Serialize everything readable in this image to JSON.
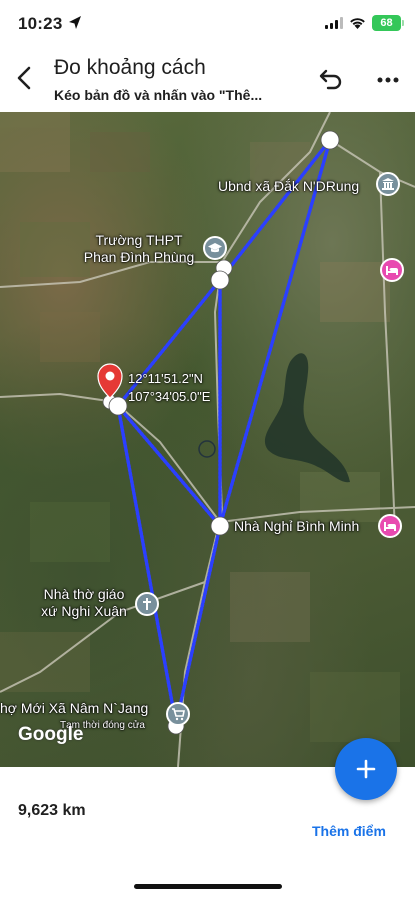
{
  "status_bar": {
    "time": "10:23",
    "battery": "68",
    "icons": [
      "location-arrow-icon",
      "signal-icon",
      "wifi-icon",
      "battery-icon"
    ]
  },
  "header": {
    "title": "Đo khoảng cách",
    "subtitle": "Kéo bản đồ và nhấn vào \"Thê...",
    "icons": [
      "back-arrow-icon",
      "undo-icon",
      "more-vert-icon"
    ]
  },
  "map": {
    "labels": {
      "ubnd": "Ubnd xã Đắk N'DRung",
      "truong_line1": "Trường THPT",
      "truong_line2": "Phan Đình Phùng",
      "nha_nghi": "Nhà Nghỉ Bình Minh",
      "nha_tho_line1": "Nhà thờ giáo",
      "nha_tho_line2": "xứ Nghi Xuân",
      "cho_moi": "hợ Mới Xã Nâm N`Jang",
      "tam_thoi": "Tạm thời đóng cửa"
    },
    "coordinates": {
      "lat": "12°11'51.2\"N",
      "lng": "107°34'05.0\"E"
    },
    "attribution": "Google",
    "colors": {
      "measure_line": "#2b3fff",
      "pin": "#e53935",
      "poi_gray": "#78909c",
      "poi_pink": "#e84ab0"
    }
  },
  "fab": {
    "icon": "plus-icon"
  },
  "bottom_sheet": {
    "distance": "9,623 km",
    "add_point": "Thêm điểm"
  }
}
